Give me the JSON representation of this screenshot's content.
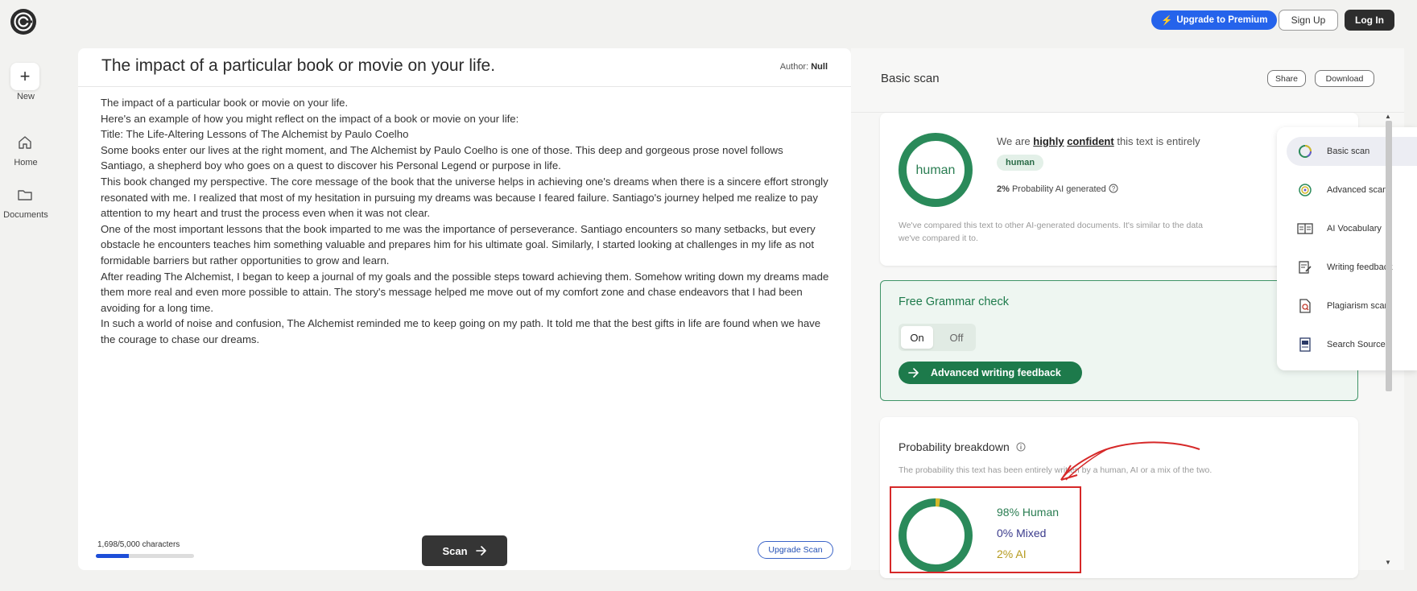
{
  "header": {
    "premium_label": "Upgrade to Premium",
    "signup_label": "Sign Up",
    "login_label": "Log In"
  },
  "sidebar": {
    "items": [
      {
        "label": "New",
        "icon": "plus-icon"
      },
      {
        "label": "Home",
        "icon": "home-icon"
      },
      {
        "label": "Documents",
        "icon": "folder-icon"
      }
    ]
  },
  "editor": {
    "title": "The impact of a particular book or movie on your life.",
    "author_label": "Author:",
    "author_value": "Null",
    "paragraphs": [
      "The impact of a particular book or movie on your life.",
      "Here's an example of how you might reflect on the impact of a book or movie on your life:",
      "Title: The Life-Altering Lessons of The Alchemist by Paulo Coelho",
      "Some books enter our lives at the right moment, and The Alchemist by Paulo Coelho is one of those. This deep and gorgeous prose novel follows Santiago, a shepherd boy who goes on a quest to discover his Personal Legend or purpose in life.",
      "This book changed my perspective. The core message of the book that the universe helps in achieving one's dreams when there is a sincere effort strongly resonated with me. I realized that most of my hesitation in pursuing my dreams was because I feared failure. Santiago's journey helped me realize to pay attention to my heart and trust the process even when it was not clear.",
      "One of the most important lessons that the book imparted to me was the importance of perseverance. Santiago encounters so many setbacks, but every obstacle he encounters teaches him something valuable and prepares him for his ultimate goal. Similarly, I started looking at challenges in my life as not formidable barriers but rather opportunities to grow and learn.",
      "After reading The Alchemist, I began to keep a journal of my goals and the possible steps toward achieving them. Somehow writing down my dreams made them more real and even more possible to attain. The story's message helped me move out of my comfort zone and chase endeavors that I had been avoiding for a long time.",
      "In such a world of noise and confusion, The Alchemist reminded me to keep going on my path. It told me that the best gifts in life are found when we have the courage to chase our dreams."
    ],
    "char_count": "1,698/5,000 characters",
    "char_progress": 0.34,
    "scan_label": "Scan",
    "upgrade_scan_label": "Upgrade Scan"
  },
  "panel": {
    "title": "Basic scan",
    "share_label": "Share",
    "download_label": "Download",
    "result": {
      "donut_label": "human",
      "conf_prefix": "We are",
      "conf_word1": "highly",
      "conf_word2": "confident",
      "conf_suffix": "this text is entirely",
      "pill": "human",
      "prob_value": "2%",
      "prob_label": "Probability AI generated",
      "compare_text": "We've compared this text to other AI-generated documents. It's similar to the data we've compared it to."
    },
    "grammar": {
      "title": "Free Grammar check",
      "on_label": "On",
      "off_label": "Off",
      "feedback_label": "Advanced writing feedback"
    },
    "breakdown": {
      "title": "Probability breakdown",
      "desc": "The probability this text has been entirely written by a human, AI or a mix of the two.",
      "human": "98% Human",
      "mixed": "0% Mixed",
      "ai": "2% AI",
      "human_fraction": 0.98,
      "ai_fraction": 0.02
    }
  },
  "side_menu": {
    "items": [
      {
        "label": "Basic scan",
        "icon": "basic-scan-icon",
        "active": true
      },
      {
        "label": "Advanced scan",
        "icon": "advanced-scan-icon",
        "active": false
      },
      {
        "label": "AI Vocabulary",
        "icon": "vocabulary-icon",
        "active": false
      },
      {
        "label": "Writing feedback",
        "icon": "writing-feedback-icon",
        "active": false
      },
      {
        "label": "Plagiarism scan",
        "icon": "plagiarism-icon",
        "active": false
      },
      {
        "label": "Search Sources",
        "icon": "search-sources-icon",
        "active": false
      }
    ]
  },
  "colors": {
    "brand_blue": "#2563eb",
    "human_green": "#2a8a5a",
    "ai_yellow": "#d4b82a",
    "annotation_red": "#d62828"
  }
}
